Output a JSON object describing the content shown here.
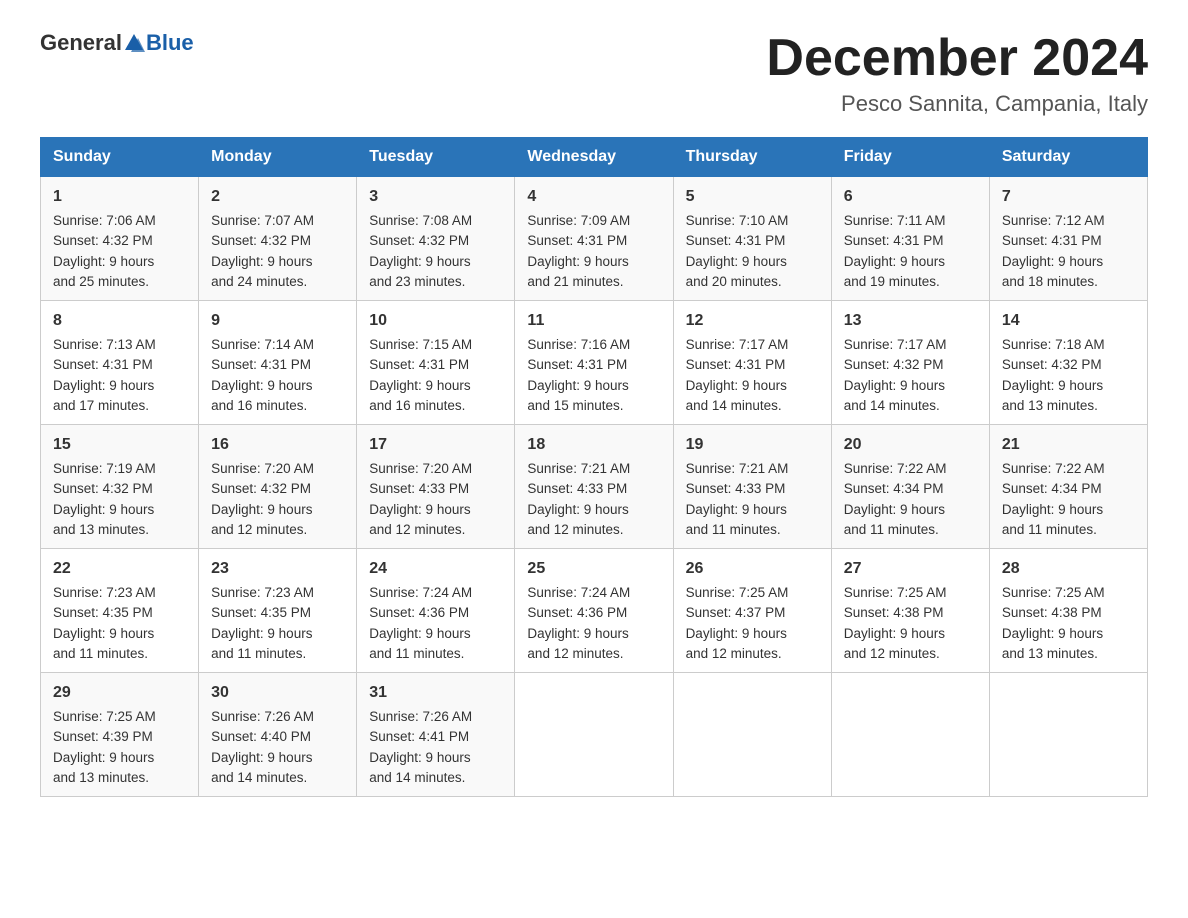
{
  "header": {
    "title": "December 2024",
    "location": "Pesco Sannita, Campania, Italy",
    "logo_general": "General",
    "logo_blue": "Blue"
  },
  "days_of_week": [
    "Sunday",
    "Monday",
    "Tuesday",
    "Wednesday",
    "Thursday",
    "Friday",
    "Saturday"
  ],
  "weeks": [
    [
      {
        "day": "1",
        "sunrise": "7:06 AM",
        "sunset": "4:32 PM",
        "daylight": "9 hours and 25 minutes."
      },
      {
        "day": "2",
        "sunrise": "7:07 AM",
        "sunset": "4:32 PM",
        "daylight": "9 hours and 24 minutes."
      },
      {
        "day": "3",
        "sunrise": "7:08 AM",
        "sunset": "4:32 PM",
        "daylight": "9 hours and 23 minutes."
      },
      {
        "day": "4",
        "sunrise": "7:09 AM",
        "sunset": "4:31 PM",
        "daylight": "9 hours and 21 minutes."
      },
      {
        "day": "5",
        "sunrise": "7:10 AM",
        "sunset": "4:31 PM",
        "daylight": "9 hours and 20 minutes."
      },
      {
        "day": "6",
        "sunrise": "7:11 AM",
        "sunset": "4:31 PM",
        "daylight": "9 hours and 19 minutes."
      },
      {
        "day": "7",
        "sunrise": "7:12 AM",
        "sunset": "4:31 PM",
        "daylight": "9 hours and 18 minutes."
      }
    ],
    [
      {
        "day": "8",
        "sunrise": "7:13 AM",
        "sunset": "4:31 PM",
        "daylight": "9 hours and 17 minutes."
      },
      {
        "day": "9",
        "sunrise": "7:14 AM",
        "sunset": "4:31 PM",
        "daylight": "9 hours and 16 minutes."
      },
      {
        "day": "10",
        "sunrise": "7:15 AM",
        "sunset": "4:31 PM",
        "daylight": "9 hours and 16 minutes."
      },
      {
        "day": "11",
        "sunrise": "7:16 AM",
        "sunset": "4:31 PM",
        "daylight": "9 hours and 15 minutes."
      },
      {
        "day": "12",
        "sunrise": "7:17 AM",
        "sunset": "4:31 PM",
        "daylight": "9 hours and 14 minutes."
      },
      {
        "day": "13",
        "sunrise": "7:17 AM",
        "sunset": "4:32 PM",
        "daylight": "9 hours and 14 minutes."
      },
      {
        "day": "14",
        "sunrise": "7:18 AM",
        "sunset": "4:32 PM",
        "daylight": "9 hours and 13 minutes."
      }
    ],
    [
      {
        "day": "15",
        "sunrise": "7:19 AM",
        "sunset": "4:32 PM",
        "daylight": "9 hours and 13 minutes."
      },
      {
        "day": "16",
        "sunrise": "7:20 AM",
        "sunset": "4:32 PM",
        "daylight": "9 hours and 12 minutes."
      },
      {
        "day": "17",
        "sunrise": "7:20 AM",
        "sunset": "4:33 PM",
        "daylight": "9 hours and 12 minutes."
      },
      {
        "day": "18",
        "sunrise": "7:21 AM",
        "sunset": "4:33 PM",
        "daylight": "9 hours and 12 minutes."
      },
      {
        "day": "19",
        "sunrise": "7:21 AM",
        "sunset": "4:33 PM",
        "daylight": "9 hours and 11 minutes."
      },
      {
        "day": "20",
        "sunrise": "7:22 AM",
        "sunset": "4:34 PM",
        "daylight": "9 hours and 11 minutes."
      },
      {
        "day": "21",
        "sunrise": "7:22 AM",
        "sunset": "4:34 PM",
        "daylight": "9 hours and 11 minutes."
      }
    ],
    [
      {
        "day": "22",
        "sunrise": "7:23 AM",
        "sunset": "4:35 PM",
        "daylight": "9 hours and 11 minutes."
      },
      {
        "day": "23",
        "sunrise": "7:23 AM",
        "sunset": "4:35 PM",
        "daylight": "9 hours and 11 minutes."
      },
      {
        "day": "24",
        "sunrise": "7:24 AM",
        "sunset": "4:36 PM",
        "daylight": "9 hours and 11 minutes."
      },
      {
        "day": "25",
        "sunrise": "7:24 AM",
        "sunset": "4:36 PM",
        "daylight": "9 hours and 12 minutes."
      },
      {
        "day": "26",
        "sunrise": "7:25 AM",
        "sunset": "4:37 PM",
        "daylight": "9 hours and 12 minutes."
      },
      {
        "day": "27",
        "sunrise": "7:25 AM",
        "sunset": "4:38 PM",
        "daylight": "9 hours and 12 minutes."
      },
      {
        "day": "28",
        "sunrise": "7:25 AM",
        "sunset": "4:38 PM",
        "daylight": "9 hours and 13 minutes."
      }
    ],
    [
      {
        "day": "29",
        "sunrise": "7:25 AM",
        "sunset": "4:39 PM",
        "daylight": "9 hours and 13 minutes."
      },
      {
        "day": "30",
        "sunrise": "7:26 AM",
        "sunset": "4:40 PM",
        "daylight": "9 hours and 14 minutes."
      },
      {
        "day": "31",
        "sunrise": "7:26 AM",
        "sunset": "4:41 PM",
        "daylight": "9 hours and 14 minutes."
      },
      null,
      null,
      null,
      null
    ]
  ],
  "labels": {
    "sunrise": "Sunrise:",
    "sunset": "Sunset:",
    "daylight": "Daylight:"
  }
}
